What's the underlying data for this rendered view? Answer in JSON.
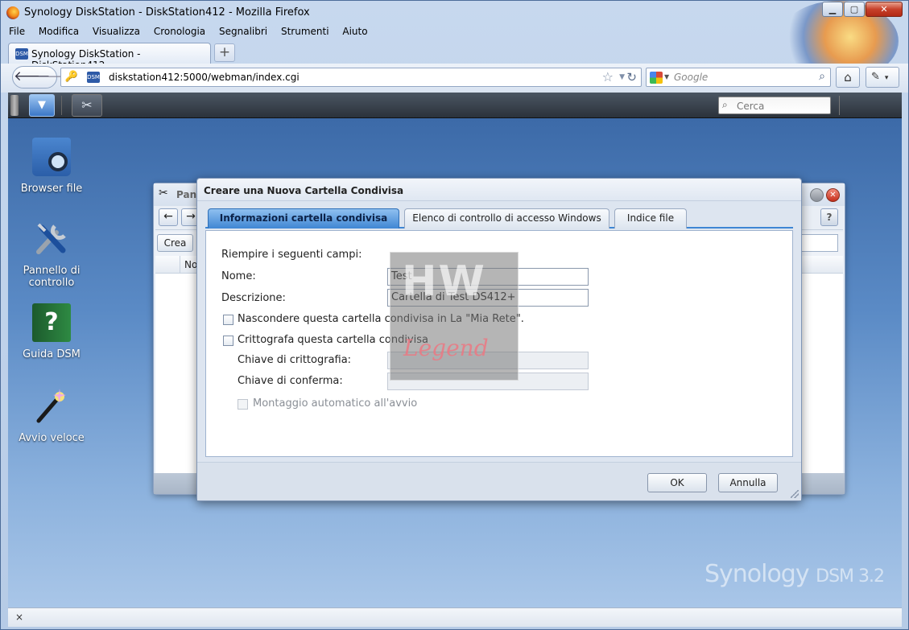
{
  "browser": {
    "window_title": "Synology DiskStation - DiskStation412 - Mozilla Firefox",
    "menu": [
      "File",
      "Modifica",
      "Visualizza",
      "Cronologia",
      "Segnalibri",
      "Strumenti",
      "Aiuto"
    ],
    "tab_label": "Synology DiskStation - DiskStation412",
    "url": "diskstation412:5000/webman/index.cgi",
    "search_placeholder": "Google",
    "status_close": "×"
  },
  "dsm": {
    "taskbar_search_placeholder": "Cerca",
    "desktop_icons": [
      {
        "label": "Browser file",
        "icon": "file-browser-icon"
      },
      {
        "label": "Pannello di controllo",
        "icon": "control-panel-icon"
      },
      {
        "label": "Guida DSM",
        "icon": "help-book-icon"
      },
      {
        "label": "Avvio veloce",
        "icon": "magic-wand-icon"
      }
    ],
    "brand_logo": "Synology DSM 3.2"
  },
  "back_window": {
    "title": "Pann",
    "create_button": "Crea",
    "column_name": "Nor"
  },
  "dialog": {
    "title": "Creare una Nuova Cartella Condivisa",
    "tabs": [
      {
        "label": "Informazioni cartella condivisa",
        "active": true
      },
      {
        "label": "Elenco di controllo di accesso Windows",
        "active": false
      },
      {
        "label": "Indice file",
        "active": false
      }
    ],
    "intro": "Riempire i seguenti campi:",
    "name_label": "Nome:",
    "name_value": "Test",
    "description_label": "Descrizione:",
    "description_value": "Cartella di Test DS412+",
    "hide_checkbox_label": "Nascondere questa cartella condivisa in La \"Mia Rete\".",
    "encrypt_checkbox_label": "Crittografa questa cartella condivisa",
    "encryption_key_label": "Chiave di crittografia:",
    "confirm_key_label": "Chiave di conferma:",
    "automount_label": "Montaggio automatico all'avvio",
    "ok_button": "OK",
    "cancel_button": "Annulla"
  },
  "watermark": {
    "top": "HW",
    "bottom": "Legend"
  }
}
